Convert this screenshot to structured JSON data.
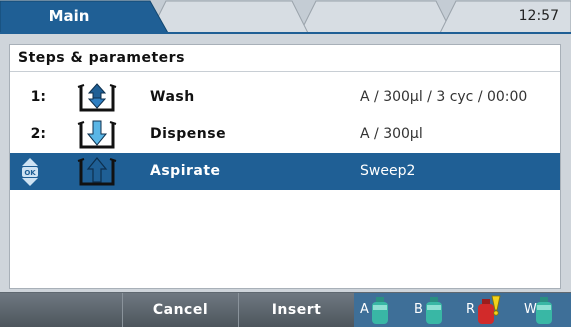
{
  "tabs": {
    "main_label": "Main",
    "clock": "12:57"
  },
  "panel": {
    "title": "Steps & parameters",
    "steps": [
      {
        "number": "1:",
        "icon": "wash-icon",
        "name": "Wash",
        "params": "A / 300µl / 3 cyc / 00:00"
      },
      {
        "number": "2:",
        "icon": "dispense-icon",
        "name": "Dispense",
        "params": "A / 300µl"
      },
      {
        "number": "",
        "icon": "aspirate-icon",
        "name": "Aspirate",
        "params": "Sweep2",
        "selected": true,
        "ok_label": "OK"
      }
    ]
  },
  "softkeys": {
    "key1": "",
    "cancel": "Cancel",
    "insert": "Insert"
  },
  "bottles": [
    {
      "label": "A",
      "color": "#39b7a5"
    },
    {
      "label": "B",
      "color": "#39b7a5"
    },
    {
      "label": "R",
      "color": "#d22a2a",
      "warning": true
    },
    {
      "label": "W",
      "color": "#39b7a5"
    }
  ],
  "colors": {
    "accent": "#1f5f95",
    "tab_active": "#1f5f95"
  }
}
